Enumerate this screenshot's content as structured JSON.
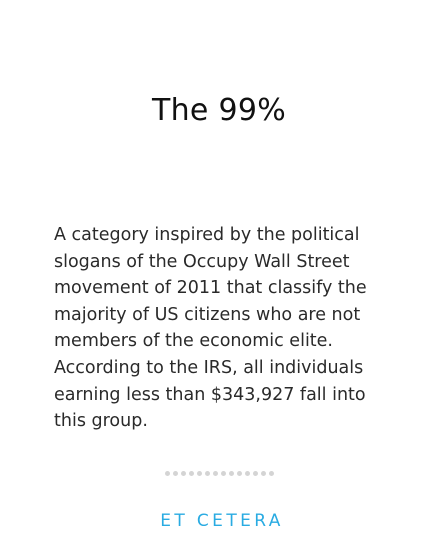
{
  "card": {
    "title": "The 99%",
    "description": "A category inspired by the political slogans of the Occupy Wall Street movement of 2011 that classify the majority of US citizens who are not members of the economic elite. According to the IRS, all individuals earning less than $343,927 fall into this group.",
    "category_label": "ET CETERA"
  },
  "pager": {
    "dot_count": 14
  },
  "colors": {
    "category_accent": "#29abe2",
    "pager_dot": "#d4d4d4",
    "text": "#1a1a1a",
    "background": "#ffffff"
  }
}
